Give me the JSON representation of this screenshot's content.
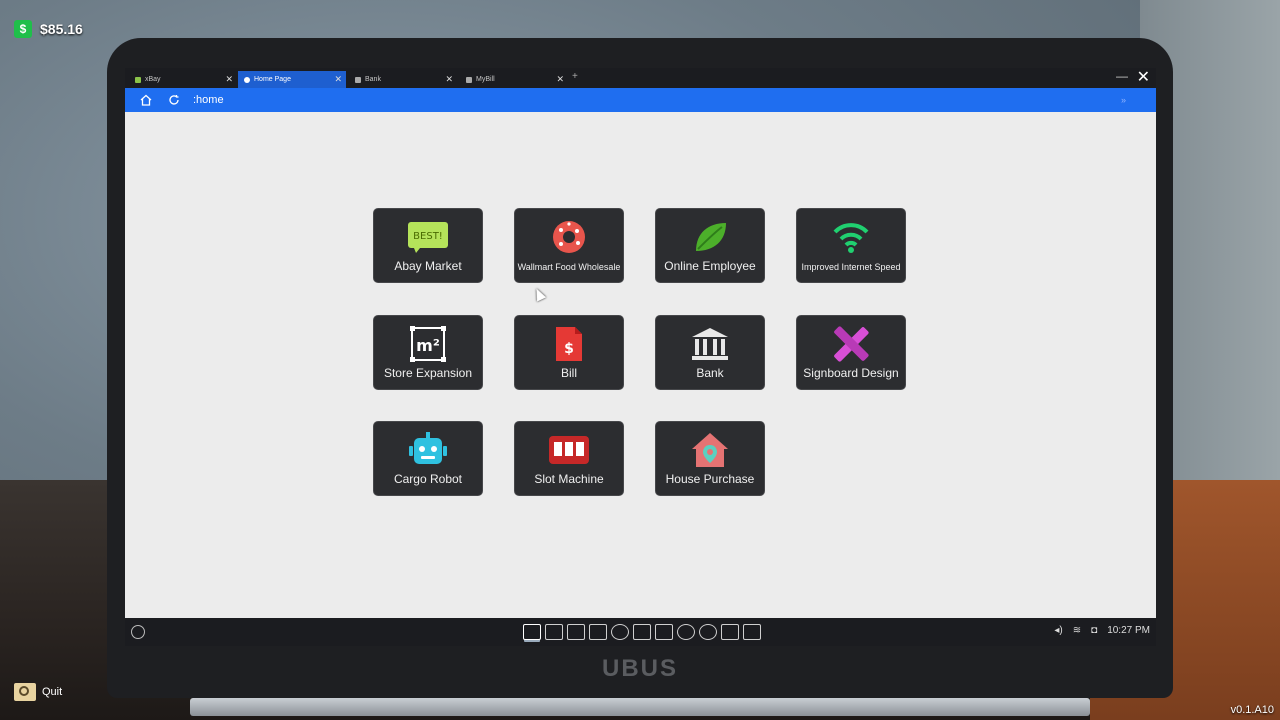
{
  "hud": {
    "money": "$85.16",
    "money_icon": "$",
    "quit_label": "Quit",
    "version": "v0.1.A10"
  },
  "laptop": {
    "brand": "UBUS"
  },
  "browser": {
    "tabs": [
      {
        "label": "xBay",
        "active": false
      },
      {
        "label": "Home Page",
        "active": true
      },
      {
        "label": "Bank",
        "active": false
      },
      {
        "label": "MyBill",
        "active": false
      }
    ],
    "url": ":home",
    "icons": {
      "home": "home-icon",
      "refresh": "refresh-icon"
    }
  },
  "apps": [
    {
      "label": "Abay Market",
      "icon": "abay-market-icon",
      "badge": "BEST!",
      "color": "#b5e35a"
    },
    {
      "label": "Wallmart Food Wholesale",
      "icon": "donut-icon",
      "color": "#e8554c"
    },
    {
      "label": "Online Employee",
      "icon": "leaf-icon",
      "color": "#4caf2a"
    },
    {
      "label": "Improved Internet Speed",
      "icon": "wifi-icon",
      "color": "#20d070"
    },
    {
      "label": "Store Expansion",
      "icon": "expansion-icon",
      "badge": "m²",
      "color": "#ffffff"
    },
    {
      "label": "Bill",
      "icon": "bill-icon",
      "badge": "$",
      "color": "#e53935"
    },
    {
      "label": "Bank",
      "icon": "bank-icon",
      "color": "#e8e8e8"
    },
    {
      "label": "Signboard Design",
      "icon": "pencil-ruler-icon",
      "color": "#d84fd6"
    },
    {
      "label": "Cargo Robot",
      "icon": "robot-icon",
      "color": "#2fc1e0"
    },
    {
      "label": "Slot Machine",
      "icon": "slot-machine-icon",
      "color": "#c62828"
    },
    {
      "label": "House Purchase",
      "icon": "house-icon",
      "color": "#e57373"
    }
  ],
  "taskbar": {
    "time": "10:27 PM",
    "apps": [
      "browser-icon",
      "calculator-icon",
      "terminal-icon",
      "gamepad-icon",
      "clock-icon",
      "phone-icon",
      "image-icon",
      "settings-icon",
      "ball-icon",
      "monitor-icon",
      "chat-icon"
    ]
  }
}
